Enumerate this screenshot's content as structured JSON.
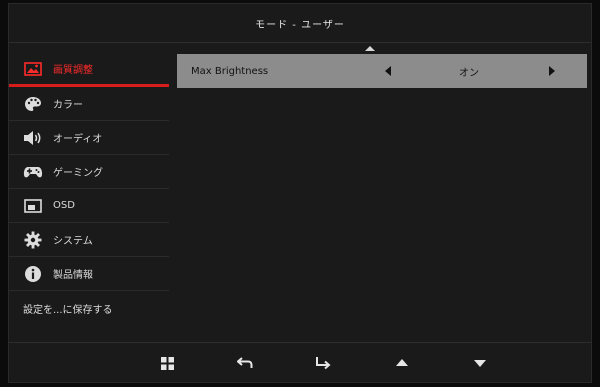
{
  "header": {
    "title": "モード - ユーザー"
  },
  "sidebar": {
    "items": [
      {
        "label": "画質調整",
        "icon": "picture-icon",
        "active": true
      },
      {
        "label": "カラー",
        "icon": "palette-icon",
        "active": false
      },
      {
        "label": "オーディオ",
        "icon": "speaker-icon",
        "active": false
      },
      {
        "label": "ゲーミング",
        "icon": "gamepad-icon",
        "active": false
      },
      {
        "label": "OSD",
        "icon": "osd-icon",
        "active": false
      },
      {
        "label": "システム",
        "icon": "gear-icon",
        "active": false
      },
      {
        "label": "製品情報",
        "icon": "info-icon",
        "active": false
      }
    ],
    "save_label": "設定を...に保存する"
  },
  "main": {
    "setting": {
      "label": "Max Brightness",
      "value": "オン"
    }
  },
  "bottom_bar": {
    "icons": [
      "grid-icon",
      "return-icon",
      "enter-icon",
      "up-icon",
      "down-icon"
    ]
  },
  "colors": {
    "accent": "#d81c1c",
    "panel_bg": "#1a1a1a",
    "selected_row": "#8c8c8c"
  }
}
